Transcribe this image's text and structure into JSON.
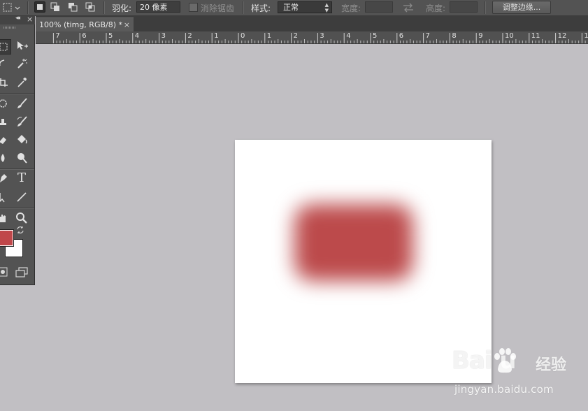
{
  "options_bar": {
    "feather_label": "羽化:",
    "feather_value": "20 像素",
    "antialias_label": "消除锯齿",
    "style_label": "样式:",
    "style_value": "正常",
    "width_label": "宽度:",
    "height_label": "高度:",
    "refine_edge_button": "调整边缘..."
  },
  "document": {
    "tab_title": "100% (timg, RGB/8) *",
    "close_glyph": "×"
  },
  "ruler": {
    "labels": [
      "7",
      "6",
      "5",
      "4",
      "3",
      "2",
      "1",
      "0",
      "1",
      "2",
      "3",
      "4",
      "5",
      "6",
      "7",
      "8",
      "9",
      "10",
      "11",
      "12",
      "13"
    ]
  },
  "tool_panel": {
    "collapse_glyph": "◂◂",
    "close_glyph": "×",
    "text_tool_glyph": "T",
    "foreground_color": "#c0474a",
    "background_color": "#ffffff"
  },
  "canvas": {
    "background_color": "#ffffff",
    "shape_color": "#bc4a4b"
  },
  "watermark": {
    "brand": "Bai  u",
    "sub": "经验",
    "url": "jingyan.baidu.com"
  }
}
